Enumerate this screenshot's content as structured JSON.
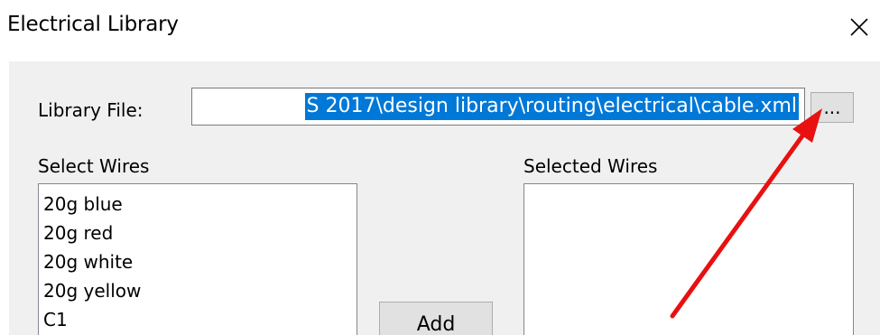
{
  "window": {
    "title": "Electrical Library",
    "close_glyph": "✕"
  },
  "library_file": {
    "label": "Library File:",
    "value": "S 2017\\design library\\routing\\electrical\\cable.xml",
    "browse_label": "..."
  },
  "select_wires": {
    "label": "Select Wires",
    "items": [
      "20g blue",
      "20g red",
      "20g white",
      "20g yellow",
      "C1"
    ]
  },
  "selected_wires": {
    "label": "Selected Wires",
    "items": []
  },
  "actions": {
    "add_label": "Add"
  },
  "colors": {
    "selection": "#0078d7",
    "arrow": "#e81010",
    "panel": "#f0f0f0"
  },
  "icons": {
    "close": "close-icon",
    "annotation": "red-arrow-annotation"
  }
}
